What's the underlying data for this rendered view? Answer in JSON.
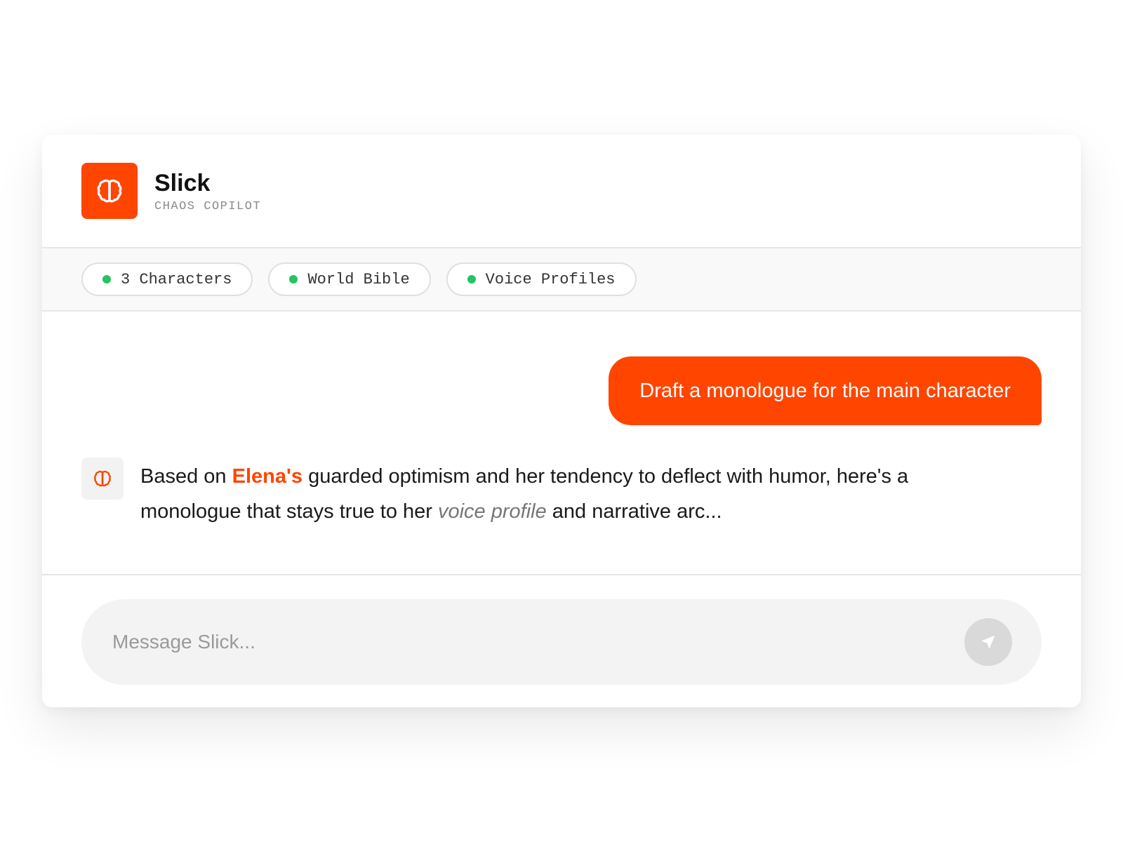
{
  "app": {
    "name": "Slick",
    "subtitle": "CHAOS COPILOT",
    "logo_icon": "brain-icon",
    "accent_color": "#ff4500"
  },
  "context_chips": [
    {
      "label": "3 Characters",
      "status_color": "#22c55e"
    },
    {
      "label": "World Bible",
      "status_color": "#22c55e"
    },
    {
      "label": "Voice Profiles",
      "status_color": "#22c55e"
    }
  ],
  "messages": {
    "user": {
      "text": "Draft a monologue for the main character"
    },
    "assistant": {
      "avatar_icon": "brain-icon",
      "part1": "Based on ",
      "highlight": "Elena's",
      "part2": " guarded optimism and her tendency to deflect with humor, here's a monologue that stays true to her ",
      "emphasis": "voice profile",
      "part3": " and narrative arc..."
    }
  },
  "composer": {
    "placeholder": "Message Slick...",
    "send_icon": "send-icon"
  }
}
